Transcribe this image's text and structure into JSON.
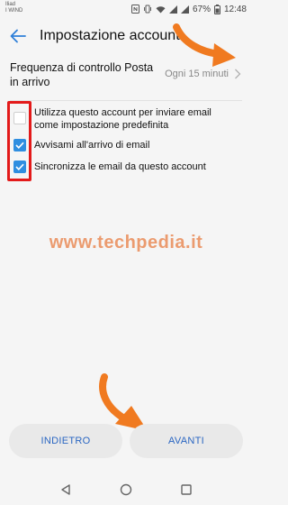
{
  "status_bar": {
    "carrier_line1": "Iliad",
    "carrier_line2": "I WIND",
    "battery": "67%",
    "time": "12:48",
    "icons": [
      "nfc-icon",
      "vibrate-icon",
      "wifi-icon",
      "signal-icon",
      "signal-icon",
      "battery-icon"
    ]
  },
  "app_bar": {
    "title": "Impostazione account",
    "back_icon": "arrow-back-icon"
  },
  "frequency": {
    "label": "Frequenza di controllo Posta in arrivo",
    "value": "Ogni 15 minuti",
    "chevron_icon": "chevron-right-icon"
  },
  "options": [
    {
      "label": "Utilizza questo account per inviare email come impostazione predefinita",
      "checked": false
    },
    {
      "label": "Avvisami all'arrivo di email",
      "checked": true
    },
    {
      "label": "Sincronizza le email da questo account",
      "checked": true
    }
  ],
  "watermark": "www.techpedia.it",
  "buttons": {
    "back": "INDIETRO",
    "next": "AVANTI"
  },
  "nav": {
    "back_icon": "triangle-back-icon",
    "home_icon": "circle-home-icon",
    "recents_icon": "square-recents-icon"
  },
  "colors": {
    "accent": "#2f8ee0",
    "button_text": "#2a66c2",
    "highlight": "#e31a1a",
    "watermark": "#e8783c",
    "arrow": "#f07a20"
  }
}
